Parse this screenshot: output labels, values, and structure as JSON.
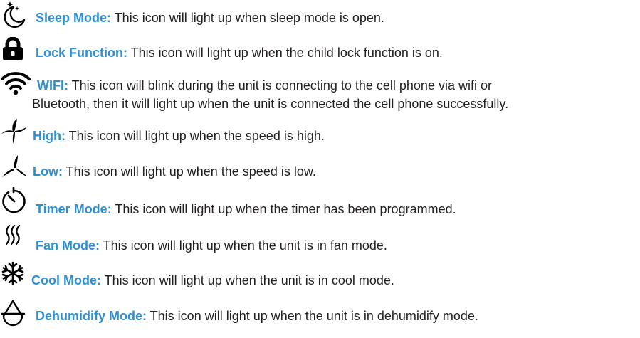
{
  "colors": {
    "label": "#2f8fd0",
    "body": "#231f20",
    "icon": "#000000"
  },
  "entries": [
    {
      "icon": "moon-stars-icon",
      "label": "Sleep Mode:",
      "text": " This icon will light up when sleep mode is open."
    },
    {
      "icon": "lock-icon",
      "label": "Lock Function:",
      "text": " This icon will light up when the child lock function is on."
    },
    {
      "icon": "wifi-icon",
      "label": "WIFI:",
      "text": " This icon will blink during the unit is connecting to the cell phone via wifi or",
      "text2": "Bluetooth, then it will light up when the unit is connected the cell phone successfully."
    },
    {
      "icon": "fan-high-icon",
      "label": "High:",
      "text": " This icon will light up when the speed is high."
    },
    {
      "icon": "fan-low-icon",
      "label": "Low:",
      "text": " This icon will light up when the speed is low."
    },
    {
      "icon": "timer-icon",
      "label": "Timer Mode:",
      "text": " This icon will light up when the timer has been programmed."
    },
    {
      "icon": "fan-mode-icon",
      "label": "Fan Mode:",
      "text": " This icon will light up when the unit is in fan mode."
    },
    {
      "icon": "snowflake-icon",
      "label": "Cool Mode:",
      "text": " This icon will light up when the unit is in cool mode."
    },
    {
      "icon": "droplet-icon",
      "label": "Dehumidify Mode:",
      "text": " This icon will light up when the unit is in dehumidify mode."
    }
  ]
}
